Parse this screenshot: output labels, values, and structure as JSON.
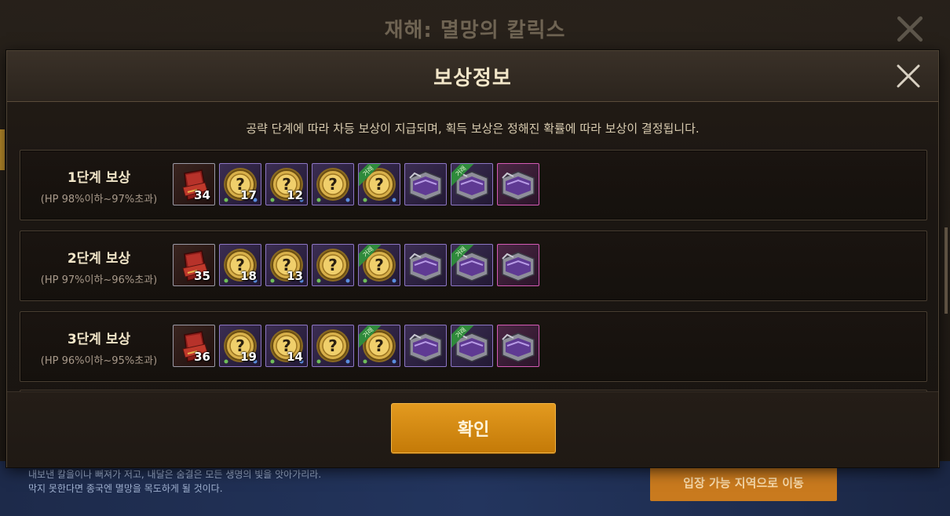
{
  "background": {
    "title": "재해: 멸망의 칼릭스",
    "story_lines": [
      "내보낸 칼을이나 뻐져가 저고, 내달은 숨결은 모든 생명의 빛을 앗아가리라.",
      "막지 못한다면 종국엔 멸망을 목도하게 될 것이다."
    ],
    "enter_button_label": "입장 가능 지역으로 이동"
  },
  "modal": {
    "title": "보상정보",
    "notice": "공략 단계에 따라 차등 보상이 지급되며, 획득 보상은 정해진 확률에 따라 보상이 결정됩니다.",
    "confirm_label": "확인"
  },
  "tier_badge_text": "거래",
  "rewards": [
    {
      "title": "1단계 보상",
      "hp_range": "(HP 98%이하~97%초과)",
      "items": [
        {
          "icon": "red-pouch-icon",
          "frame": "dark",
          "count": "34"
        },
        {
          "icon": "gold-mystery-coin-icon",
          "frame": "purple",
          "count": "17"
        },
        {
          "icon": "gold-mystery-coin-icon",
          "frame": "purple",
          "count": "12"
        },
        {
          "icon": "gold-mystery-coin-icon",
          "frame": "purple",
          "count": ""
        },
        {
          "icon": "gold-mystery-coin-tradable-icon",
          "frame": "purple",
          "count": ""
        },
        {
          "icon": "purple-chest-icon",
          "frame": "purple",
          "count": ""
        },
        {
          "icon": "purple-chest-tradable-icon",
          "frame": "purple",
          "count": ""
        },
        {
          "icon": "purple-chest-icon",
          "frame": "pink",
          "count": ""
        }
      ]
    },
    {
      "title": "2단계 보상",
      "hp_range": "(HP 97%이하~96%초과)",
      "items": [
        {
          "icon": "red-pouch-icon",
          "frame": "dark",
          "count": "35"
        },
        {
          "icon": "gold-mystery-coin-icon",
          "frame": "purple",
          "count": "18"
        },
        {
          "icon": "gold-mystery-coin-icon",
          "frame": "purple",
          "count": "13"
        },
        {
          "icon": "gold-mystery-coin-icon",
          "frame": "purple",
          "count": ""
        },
        {
          "icon": "gold-mystery-coin-tradable-icon",
          "frame": "purple",
          "count": ""
        },
        {
          "icon": "purple-chest-icon",
          "frame": "purple",
          "count": ""
        },
        {
          "icon": "purple-chest-tradable-icon",
          "frame": "purple",
          "count": ""
        },
        {
          "icon": "purple-chest-icon",
          "frame": "pink",
          "count": ""
        }
      ]
    },
    {
      "title": "3단계 보상",
      "hp_range": "(HP 96%이하~95%초과)",
      "items": [
        {
          "icon": "red-pouch-icon",
          "frame": "dark",
          "count": "36"
        },
        {
          "icon": "gold-mystery-coin-icon",
          "frame": "purple",
          "count": "19"
        },
        {
          "icon": "gold-mystery-coin-icon",
          "frame": "purple",
          "count": "14"
        },
        {
          "icon": "gold-mystery-coin-icon",
          "frame": "purple",
          "count": ""
        },
        {
          "icon": "gold-mystery-coin-tradable-icon",
          "frame": "purple",
          "count": ""
        },
        {
          "icon": "purple-chest-icon",
          "frame": "purple",
          "count": ""
        },
        {
          "icon": "purple-chest-tradable-icon",
          "frame": "purple",
          "count": ""
        },
        {
          "icon": "purple-chest-icon",
          "frame": "pink",
          "count": ""
        }
      ]
    }
  ],
  "colors": {
    "accent_button": "#e39a1f",
    "title_text": "#f2e6c9",
    "tradable_badge": "#2f8a3c"
  }
}
